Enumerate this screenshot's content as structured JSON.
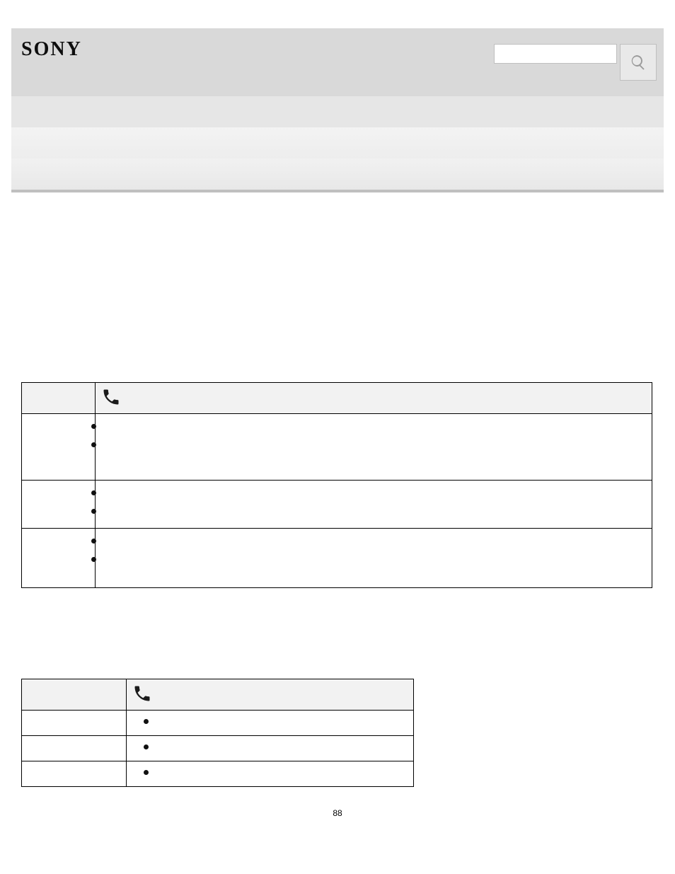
{
  "header": {
    "logo_text": "Sony",
    "search_placeholder": ""
  },
  "table1": {
    "header_icon": "phone-icon",
    "rows": [
      {
        "left": "",
        "bullets": [
          "",
          ""
        ]
      },
      {
        "left": "",
        "bullets": [
          "",
          ""
        ]
      },
      {
        "left": "",
        "bullets": [
          "",
          ""
        ]
      }
    ]
  },
  "table2": {
    "header_icon": "phone-icon",
    "rows": [
      {
        "left": "",
        "bullets": [
          ""
        ]
      },
      {
        "left": "",
        "bullets": [
          ""
        ]
      },
      {
        "left": "",
        "bullets": [
          ""
        ]
      }
    ]
  },
  "page_number": "88"
}
